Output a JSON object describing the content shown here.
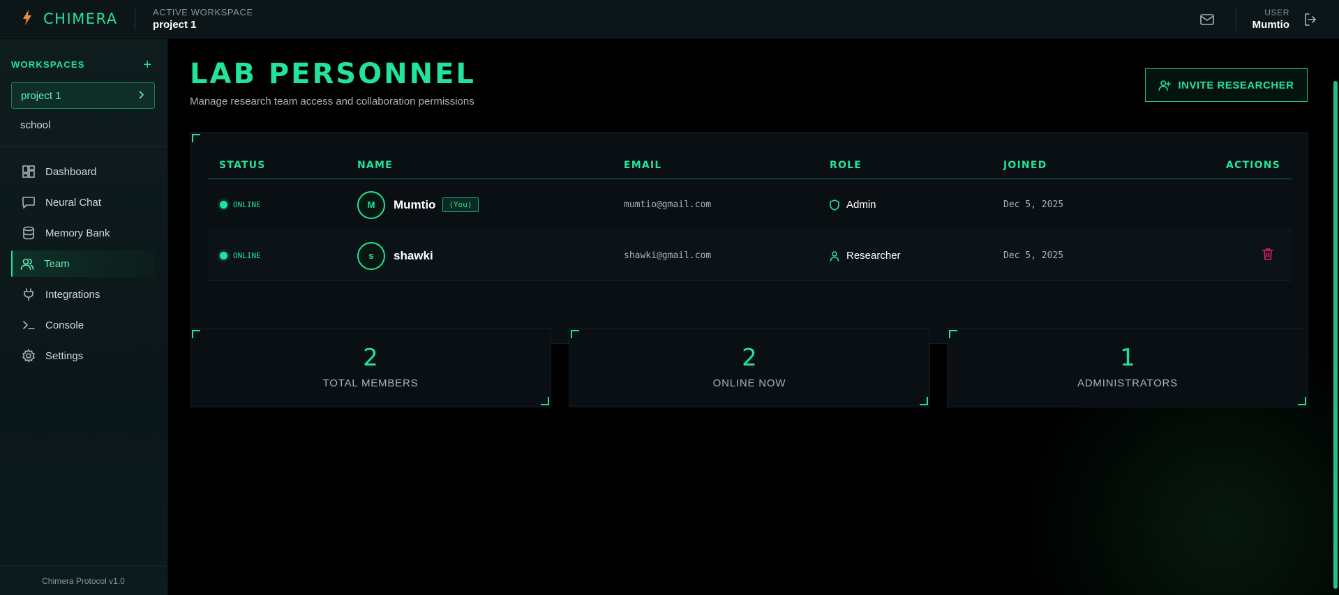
{
  "app": {
    "name": "CHIMERA",
    "version": "Chimera Protocol v1.0"
  },
  "header": {
    "workspace_label": "ACTIVE WORKSPACE",
    "workspace_value": "project 1",
    "user_label": "USER",
    "user_value": "Mumtio"
  },
  "sidebar": {
    "workspaces_title": "WORKSPACES",
    "add_symbol": "+",
    "workspaces": [
      {
        "label": "project 1",
        "active": true
      },
      {
        "label": "school",
        "active": false
      }
    ],
    "nav": [
      {
        "label": "Dashboard",
        "icon": "dashboard-icon"
      },
      {
        "label": "Neural Chat",
        "icon": "chat-icon"
      },
      {
        "label": "Memory Bank",
        "icon": "database-icon"
      },
      {
        "label": "Team",
        "icon": "users-icon",
        "active": true
      },
      {
        "label": "Integrations",
        "icon": "plug-icon"
      },
      {
        "label": "Console",
        "icon": "terminal-icon"
      },
      {
        "label": "Settings",
        "icon": "gear-icon"
      }
    ]
  },
  "page": {
    "title": "LAB PERSONNEL",
    "subtitle": "Manage research team access and collaboration permissions",
    "invite_label": "INVITE RESEARCHER"
  },
  "table": {
    "columns": [
      "STATUS",
      "NAME",
      "EMAIL",
      "ROLE",
      "JOINED",
      "ACTIONS"
    ],
    "rows": [
      {
        "status": "ONLINE",
        "initial": "M",
        "name": "Mumtio",
        "badge": "(You)",
        "email": "mumtio@gmail.com",
        "role": "Admin",
        "role_icon": "shield-icon",
        "joined": "Dec 5, 2025"
      },
      {
        "status": "ONLINE",
        "initial": "s",
        "name": "shawki",
        "badge": "",
        "email": "shawki@gmail.com",
        "role": "Researcher",
        "role_icon": "user-icon",
        "joined": "Dec 5, 2025",
        "action_icon": "trash-icon"
      }
    ]
  },
  "stats": [
    {
      "value": "2",
      "label": "TOTAL MEMBERS"
    },
    {
      "value": "2",
      "label": "ONLINE NOW"
    },
    {
      "value": "1",
      "label": "ADMINISTRATORS"
    }
  ],
  "colors": {
    "accent": "#22e39a",
    "danger": "#e0245e",
    "brand_bolt": "#f08a3a"
  }
}
